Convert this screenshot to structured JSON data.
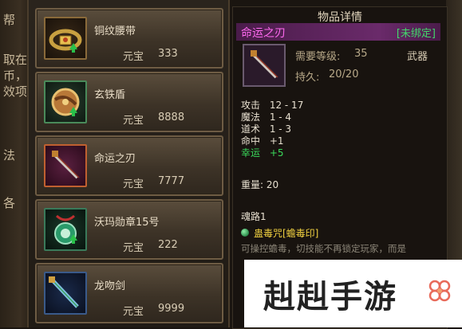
{
  "background_fragments": [
    "帮",
    "取在",
    "币，",
    "效项",
    "法",
    "各"
  ],
  "shop": {
    "items": [
      {
        "name": "铜纹腰带",
        "price_label": "元宝",
        "price": "333",
        "icon": "belt-icon",
        "upgrade": true
      },
      {
        "name": "玄铁盾",
        "price_label": "元宝",
        "price": "8888",
        "icon": "shield-icon",
        "upgrade": true
      },
      {
        "name": "命运之刃",
        "price_label": "元宝",
        "price": "7777",
        "icon": "sword-icon",
        "upgrade": false
      },
      {
        "name": "沃玛勋章15号",
        "price_label": "元宝",
        "price": "222",
        "icon": "medal-icon",
        "upgrade": true
      },
      {
        "name": "龙吻剑",
        "price_label": "元宝",
        "price": "9999",
        "icon": "dragon-sword-icon",
        "upgrade": false
      }
    ]
  },
  "detail": {
    "header": "物品详情",
    "item_name": "命运之刃",
    "bind_status": "[未绑定]",
    "required_level_label": "需要等级:",
    "required_level": "35",
    "item_type": "武器",
    "durability_label": "持久:",
    "durability": "20/20",
    "stats": [
      {
        "label": "攻击",
        "value": "12 - 17"
      },
      {
        "label": "魔法",
        "value": "1 - 4"
      },
      {
        "label": "道术",
        "value": "1 - 3"
      },
      {
        "label": "命中",
        "value": "+1"
      },
      {
        "label": "幸运",
        "value": "+5"
      }
    ],
    "weight_label": "重量:",
    "weight": "20",
    "soul_label": "魂路1",
    "skill_name": "蛊毒咒[蟾毒印]",
    "skill_desc": "可操控蟾毒，切技能不再锁定玩家，而是"
  },
  "watermark": {
    "text": "赳赳手游"
  },
  "colors": {
    "title_purple": "#ff6af0",
    "bind_green": "#43d86b",
    "skill_yellow": "#f0d040",
    "luck_green": "#3ad85a"
  }
}
